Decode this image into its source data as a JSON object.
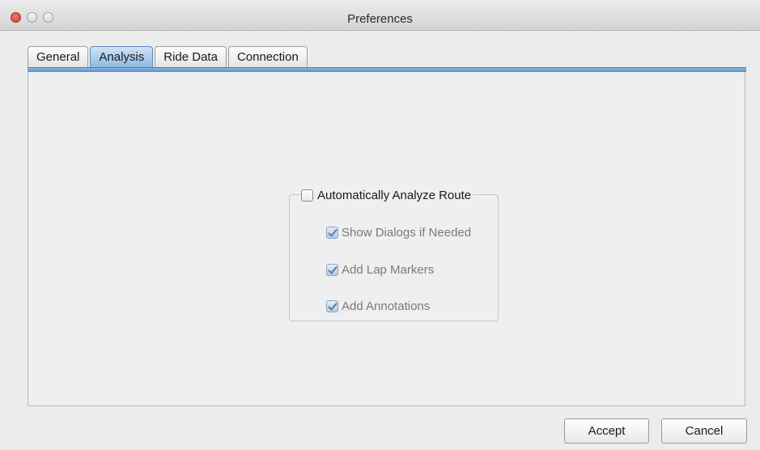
{
  "window": {
    "title": "Preferences"
  },
  "tabs": [
    {
      "label": "General",
      "active": false
    },
    {
      "label": "Analysis",
      "active": true
    },
    {
      "label": "Ride Data",
      "active": false
    },
    {
      "label": "Connection",
      "active": false
    }
  ],
  "analysis": {
    "auto_analyze": {
      "label": "Automatically Analyze Route",
      "checked": false
    },
    "options": [
      {
        "label": "Show Dialogs if Needed",
        "checked": true,
        "enabled": false
      },
      {
        "label": "Add Lap Markers",
        "checked": true,
        "enabled": false
      },
      {
        "label": "Add Annotations",
        "checked": true,
        "enabled": false
      }
    ]
  },
  "footer": {
    "accept_label": "Accept",
    "cancel_label": "Cancel"
  },
  "colors": {
    "tab_accent": "#5b8fc9",
    "close_button": "#c9372a"
  }
}
